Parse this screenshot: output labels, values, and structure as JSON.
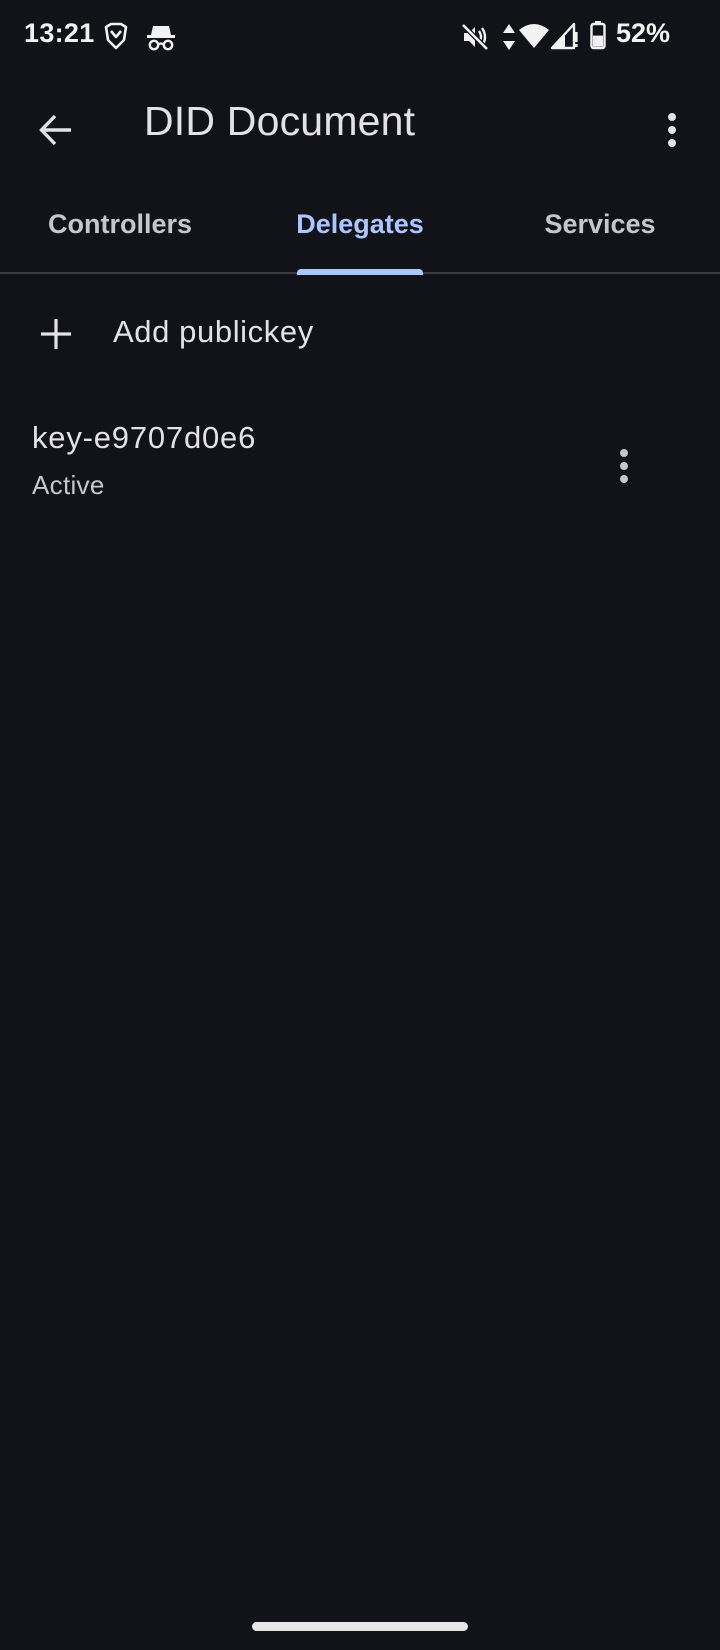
{
  "status_bar": {
    "time": "13:21",
    "battery_percent": "52%",
    "icons": [
      "brave-icon",
      "incognito-icon",
      "mute-icon",
      "data-arrows-icon",
      "wifi-icon",
      "signal-icon",
      "battery-icon"
    ],
    "battery_level": 0.52
  },
  "app_bar": {
    "title": "DID Document",
    "back_icon": "arrow-back-icon",
    "overflow_icon": "more-vert-icon"
  },
  "tabs": [
    {
      "label": "Controllers",
      "active": false
    },
    {
      "label": "Delegates",
      "active": true
    },
    {
      "label": "Services",
      "active": false
    }
  ],
  "add_action": {
    "label": "Add publickey",
    "icon": "plus-icon"
  },
  "keys": [
    {
      "name": "key-e9707d0e6",
      "status": "Active",
      "menu_icon": "more-vert-icon"
    }
  ],
  "colors": {
    "background": "#121318",
    "accent": "#aec6ff",
    "text_primary": "#e3e2e6",
    "text_secondary": "#c6c6cf",
    "divider": "#3a3b42"
  }
}
